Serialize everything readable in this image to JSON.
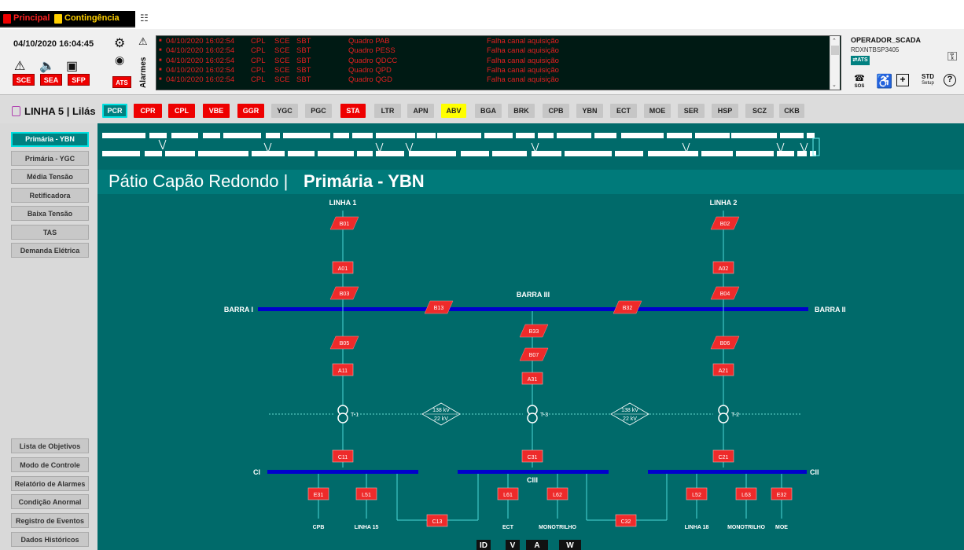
{
  "menu": {
    "principal": "Principal",
    "contingencia": "Contingência"
  },
  "header": {
    "datetime": "04/10/2020 16:04:45",
    "sce": "SCE",
    "sea": "SEA",
    "sfp": "SFP",
    "ats": "ATS",
    "alarms_label": "Alarmes"
  },
  "alarms": [
    {
      "date": "04/10/2020 16:02:54",
      "line": "CPL",
      "sys": "SCE",
      "station": "SBT",
      "equip": "Quadro PAB",
      "desc": "Falha canal aquisição"
    },
    {
      "date": "04/10/2020 16:02:54",
      "line": "CPL",
      "sys": "SCE",
      "station": "SBT",
      "equip": "Quadro PESS",
      "desc": "Falha canal aquisição"
    },
    {
      "date": "04/10/2020 16:02:54",
      "line": "CPL",
      "sys": "SCE",
      "station": "SBT",
      "equip": "Quadro QDCC",
      "desc": "Falha canal aquisição"
    },
    {
      "date": "04/10/2020 16:02:54",
      "line": "CPL",
      "sys": "SCE",
      "station": "SBT",
      "equip": "Quadro QPD",
      "desc": "Falha canal aquisição"
    },
    {
      "date": "04/10/2020 16:02:54",
      "line": "CPL",
      "sys": "SCE",
      "station": "SBT",
      "equip": "Quadro QGD",
      "desc": "Falha canal aquisição"
    }
  ],
  "operator": {
    "name": "OPERADOR_SCADA",
    "host": "RDXNTBSP3405",
    "ats_badge": "ATS",
    "sos": "SOS",
    "std": "STD",
    "setup": "Setup"
  },
  "line_title": "LINHA 5 | Lilás",
  "tabs": [
    {
      "label": "PCR",
      "style": "active"
    },
    {
      "label": "CPR",
      "style": "red"
    },
    {
      "label": "CPL",
      "style": "red"
    },
    {
      "label": "VBE",
      "style": "red"
    },
    {
      "label": "GGR",
      "style": "red"
    },
    {
      "label": "YGC",
      "style": "grey"
    },
    {
      "label": "PGC",
      "style": "grey"
    },
    {
      "label": "STA",
      "style": "red"
    },
    {
      "label": "LTR",
      "style": "grey"
    },
    {
      "label": "APN",
      "style": "grey"
    },
    {
      "label": "ABV",
      "style": "yellow"
    },
    {
      "label": "BGA",
      "style": "grey"
    },
    {
      "label": "BRK",
      "style": "grey"
    },
    {
      "label": "CPB",
      "style": "grey"
    },
    {
      "label": "YBN",
      "style": "grey"
    },
    {
      "label": "ECT",
      "style": "grey"
    },
    {
      "label": "MOE",
      "style": "grey"
    },
    {
      "label": "SER",
      "style": "grey"
    },
    {
      "label": "HSP",
      "style": "grey"
    },
    {
      "label": "SCZ",
      "style": "grey"
    },
    {
      "label": "CKB",
      "style": "grey"
    }
  ],
  "sidebar_top": [
    {
      "label": "Primária - YBN",
      "active": true
    },
    {
      "label": "Primária - YGC",
      "active": false
    },
    {
      "label": "Média Tensão",
      "active": false
    },
    {
      "label": "Retificadora",
      "active": false
    },
    {
      "label": "Baixa Tensão",
      "active": false
    },
    {
      "label": "TAS",
      "active": false
    },
    {
      "label": "Demanda Elétrica",
      "active": false
    }
  ],
  "sidebar_bottom": [
    {
      "label": "Lista de Objetivos"
    },
    {
      "label": "Modo de Controle"
    },
    {
      "label": "Relatório de Alarmes"
    },
    {
      "label": "Condição Anormal"
    },
    {
      "label": "Registro de Eventos"
    },
    {
      "label": "Dados Históricos"
    }
  ],
  "page": {
    "title_prefix": "Pátio Capão Redondo |",
    "title_bold": "Primária - YBN"
  },
  "diagram": {
    "linha1": "LINHA 1",
    "linha2": "LINHA 2",
    "barra1": "BARRA I",
    "barra2": "BARRA II",
    "barra3": "BARRA III",
    "ci": "CI",
    "cii": "CII",
    "ciii": "CIII",
    "t1": "T-1",
    "t2": "T-2",
    "t3": "T-3",
    "kv_hi": "138 kV",
    "kv_lo": "22 kV",
    "breakers": [
      "B01",
      "B02",
      "A01",
      "A02",
      "B03",
      "B04",
      "B13",
      "B32",
      "B33",
      "B07",
      "B05",
      "B06",
      "A11",
      "A21",
      "A31",
      "C11",
      "C31",
      "C21",
      "E31",
      "L51",
      "L61",
      "L62",
      "L52",
      "L63",
      "E32",
      "C13",
      "C32"
    ],
    "feeders": [
      "CPB",
      "LINHA 15",
      "ECT",
      "MONOTRILHO",
      "LINHA 18",
      "MONOTRILHO",
      "MOE"
    ]
  },
  "footer_buttons": [
    "ID",
    "V",
    "A",
    "W"
  ],
  "colors": {
    "teal_bg": "#006a6a",
    "alarm_red": "#e00000",
    "bus_blue": "#0000cc",
    "breaker_red": "#ee2a2a"
  }
}
